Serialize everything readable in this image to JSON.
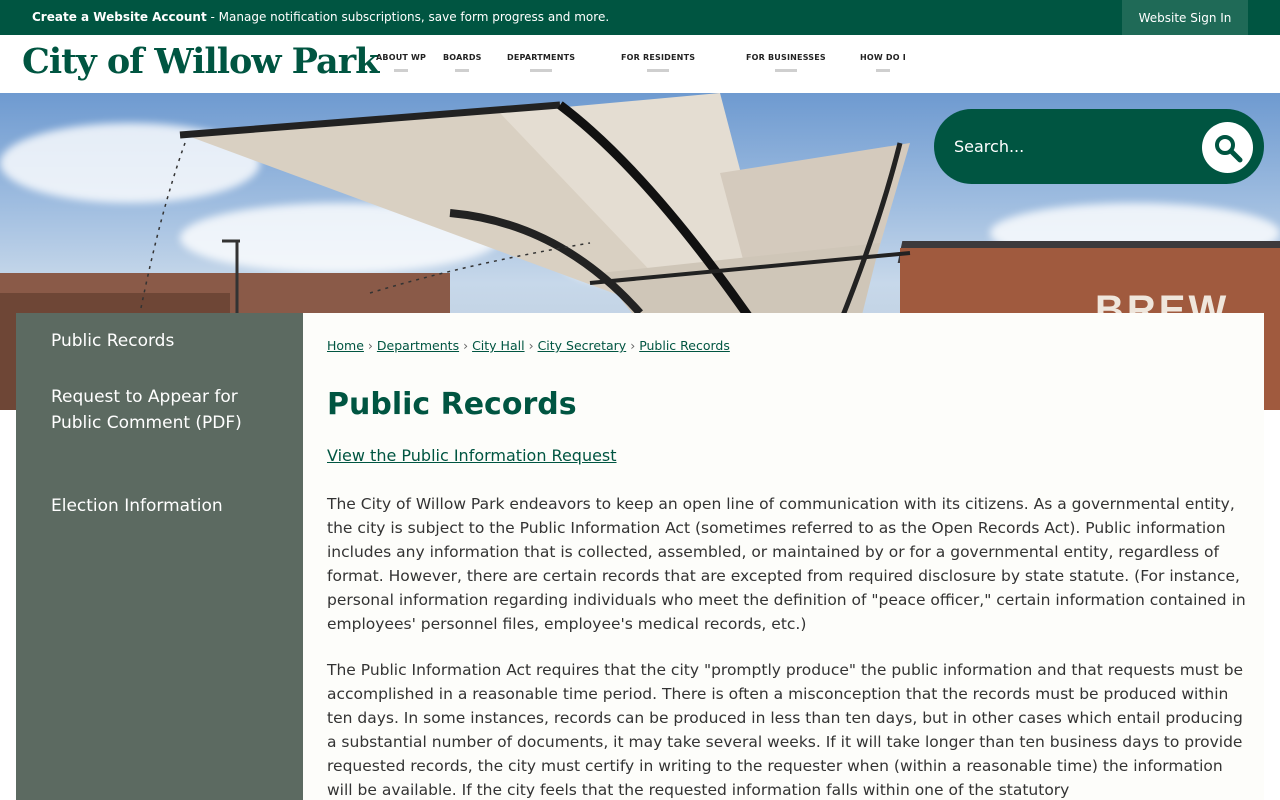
{
  "topbar": {
    "notice_bold": "Create a Website Account",
    "notice_rest": " - Manage notification subscriptions, save form progress and more.",
    "signin_label": "Website Sign In"
  },
  "header": {
    "logo": "City of Willow Park",
    "nav": [
      "ABOUT WP",
      "BOARDS",
      "DEPARTMENTS",
      "FOR RESIDENTS",
      "FOR BUSINESSES",
      "HOW DO I"
    ]
  },
  "hero": {
    "sign_text": "BREW"
  },
  "search": {
    "placeholder": "Search..."
  },
  "sidebar": {
    "items": [
      "Public Records",
      "Request to Appear for Public Comment (PDF)",
      "Election Information"
    ]
  },
  "breadcrumb": [
    "Home",
    "Departments",
    "City Hall",
    "City Secretary",
    "Public Records"
  ],
  "breadcrumb_sep": "›",
  "main": {
    "title": "Public Records",
    "request_link": "View the Public Information Request",
    "paragraphs": [
      "The City of Willow Park endeavors to keep an open line of communication with its citizens. As a governmental entity, the city is subject to the Public Information Act (sometimes referred to as the Open Records Act). Public information includes any information that is collected, assembled, or maintained by or for a governmental entity, regardless of format. However, there are certain records that are excepted from required disclosure by state statute. (For instance, personal information regarding individuals who meet the definition of \"peace officer,\" certain information contained in employees' personnel files, employee's medical records, etc.)",
      "The Public Information Act requires that the city \"promptly produce\" the public information and that requests must be accomplished in a reasonable time period. There is often a misconception that the records must be produced within ten days. In some instances, records can be produced in less than ten days, but in other cases which entail producing a substantial number of documents, it may take several weeks. If it will take longer than ten business days to provide requested records, the city must certify in writing to the requester when (within a reasonable time) the information will be available. If the city feels that the requested information falls within one of the statutory"
    ]
  },
  "colors": {
    "brand": "#005541",
    "sidebar": "#5c6a61"
  }
}
